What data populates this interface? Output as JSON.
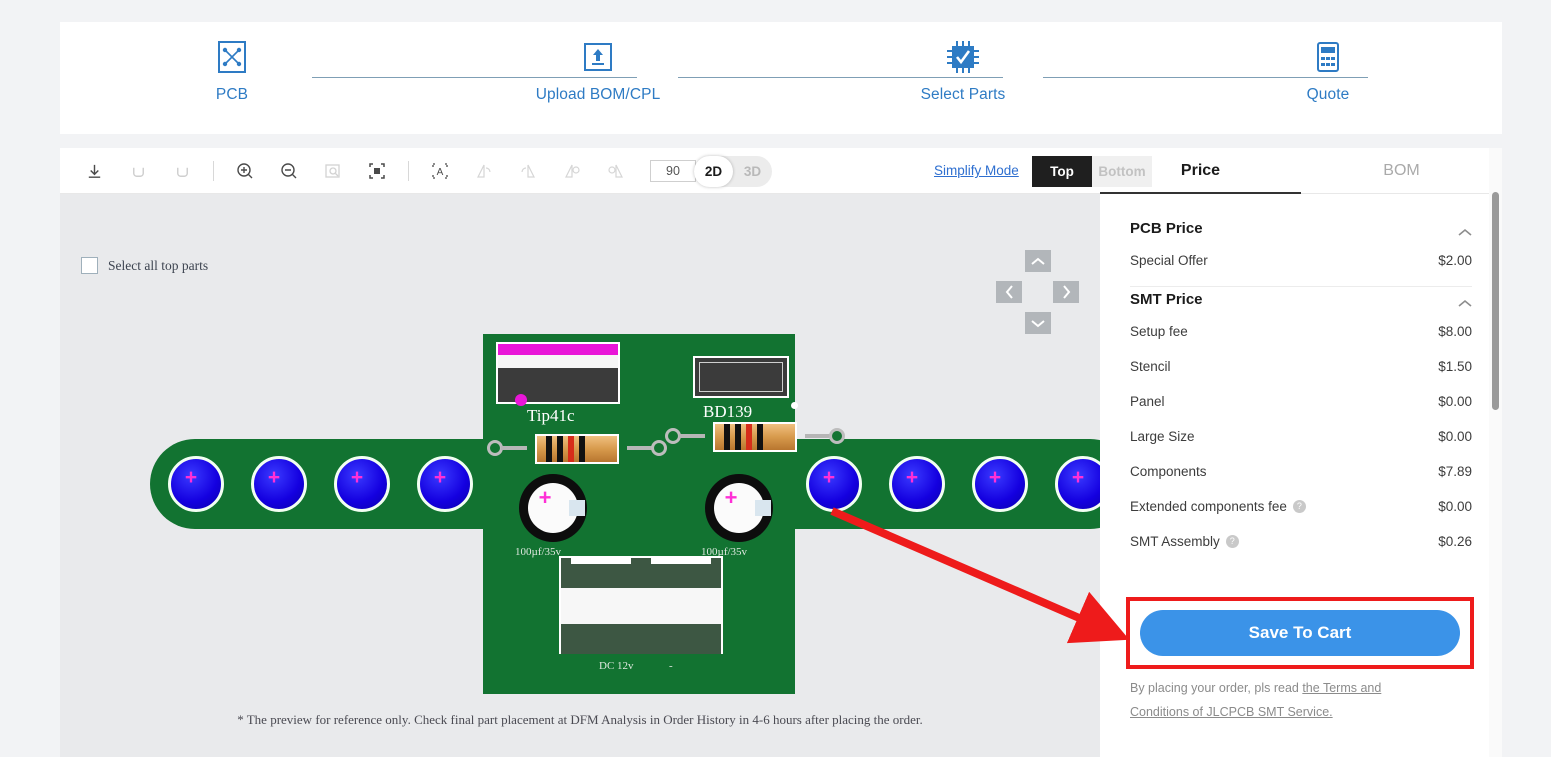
{
  "stepper": {
    "steps": [
      {
        "label": "PCB",
        "icon": "pcb-icon"
      },
      {
        "label": "Upload BOM/CPL",
        "icon": "upload-icon"
      },
      {
        "label": "Select Parts",
        "icon": "chip-check-icon"
      },
      {
        "label": "Quote",
        "icon": "calculator-icon"
      }
    ]
  },
  "toolbar": {
    "buttons": [
      {
        "name": "download-icon",
        "enabled": true
      },
      {
        "name": "undo-icon",
        "enabled": false
      },
      {
        "name": "redo-icon",
        "enabled": false
      },
      {
        "name": "zoom-in-icon",
        "enabled": true
      },
      {
        "name": "zoom-out-icon",
        "enabled": false
      },
      {
        "name": "zoom-region-icon",
        "enabled": false
      },
      {
        "name": "fit-screen-icon",
        "enabled": true
      },
      {
        "name": "select-text-icon",
        "enabled": true
      },
      {
        "name": "flip-horizontal-icon",
        "enabled": false
      },
      {
        "name": "flip-vertical-icon",
        "enabled": false
      },
      {
        "name": "rotate-cw-icon",
        "enabled": false
      },
      {
        "name": "rotate-ccw-icon",
        "enabled": false
      }
    ],
    "rotation_value": "90",
    "dimension": {
      "options": [
        "2D",
        "3D"
      ],
      "selected": "2D"
    },
    "simplify_mode": "Simplify Mode",
    "side": {
      "options": [
        "Top",
        "Bottom"
      ],
      "selected": "Top"
    }
  },
  "right_tabs": {
    "items": [
      "Price",
      "BOM"
    ],
    "selected": "Price"
  },
  "canvas": {
    "select_all_label": "Select all top parts",
    "footer_note": "* The preview for reference only. Check final part placement at DFM Analysis in Order History in 4-6 hours after placing the order.",
    "silkscreen": {
      "transistor": "Tip41c",
      "transistor2": "BD139",
      "cap_left": "100µf/35v",
      "cap_right": "100µf/35v",
      "connector": "DC 12v",
      "connector_minus": "-"
    }
  },
  "price": {
    "sections": [
      {
        "title": "PCB Price",
        "rows": [
          {
            "label": "Special Offer",
            "value": "$2.00",
            "help": false
          }
        ]
      },
      {
        "title": "SMT Price",
        "rows": [
          {
            "label": "Setup fee",
            "value": "$8.00",
            "help": false
          },
          {
            "label": "Stencil",
            "value": "$1.50",
            "help": false
          },
          {
            "label": "Panel",
            "value": "$0.00",
            "help": false
          },
          {
            "label": "Large Size",
            "value": "$0.00",
            "help": false
          },
          {
            "label": "Components",
            "value": "$7.89",
            "help": false
          },
          {
            "label": "Extended components fee",
            "value": "$0.00",
            "help": true
          },
          {
            "label": "SMT Assembly",
            "value": "$0.26",
            "help": true
          }
        ]
      }
    ],
    "save_button": "Save To Cart",
    "terms_prefix": "By placing your order, pls read ",
    "terms_link": "the Terms and Conditions of JLCPCB SMT Service."
  },
  "colors": {
    "accent_blue": "#2e7bc4",
    "button_blue": "#3b93e8",
    "annotation_red": "#ee1b1b",
    "pcb_green": "#127331",
    "led_blue": "#1400e0",
    "silk_magenta": "#e916d8"
  }
}
